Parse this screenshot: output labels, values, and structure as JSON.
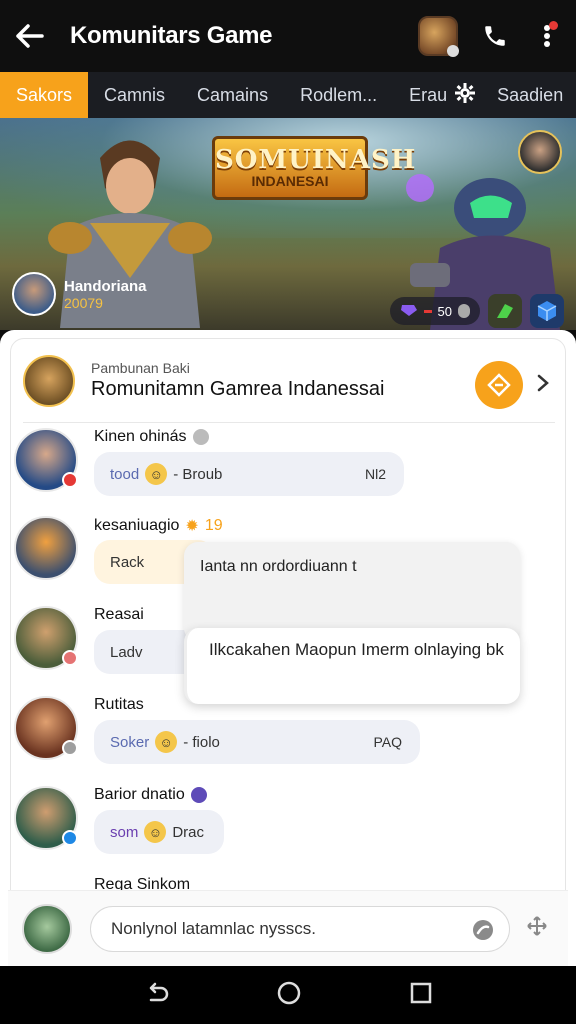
{
  "appbar": {
    "title": "Komunitars Game"
  },
  "tabs": [
    "Sakors",
    "Camnis",
    "Camains",
    "Rodlem...",
    "Erau",
    "Saadien"
  ],
  "banner": {
    "logo_line1": "SOMUINASH",
    "logo_line2": "INDANESAI",
    "streamer_name": "Handoriana",
    "streamer_count": "20079",
    "stat_value": "50"
  },
  "group": {
    "subtitle": "Pambunan Baki",
    "name": "Romunitamn Gamrea Indanessai"
  },
  "messages": [
    {
      "name": "Kinen ohinás",
      "text": "tood",
      "extra": "- Broub",
      "right": "Nl2"
    },
    {
      "name": "kesaniuagio",
      "level": "19",
      "text": "Rack"
    },
    {
      "name": "Reasai",
      "text": "Ladv"
    },
    {
      "name": "Rutitas",
      "text": "Soker",
      "extra": "- fiolo",
      "right": "PAQ"
    },
    {
      "name": "Barior dnatio",
      "text": "som",
      "extra": "Drac"
    },
    {
      "name": "Rega Sinkom"
    }
  ],
  "popup": {
    "line1": "Ianta nn ordordiuann t",
    "line2": "Ilkcakahen Maopun Imerm olnlaying bk"
  },
  "composer": {
    "placeholder": "Nonlynol latamnlac nysscs."
  },
  "colors": {
    "accent": "#f7a21b",
    "bubble": "#eef0f6"
  }
}
